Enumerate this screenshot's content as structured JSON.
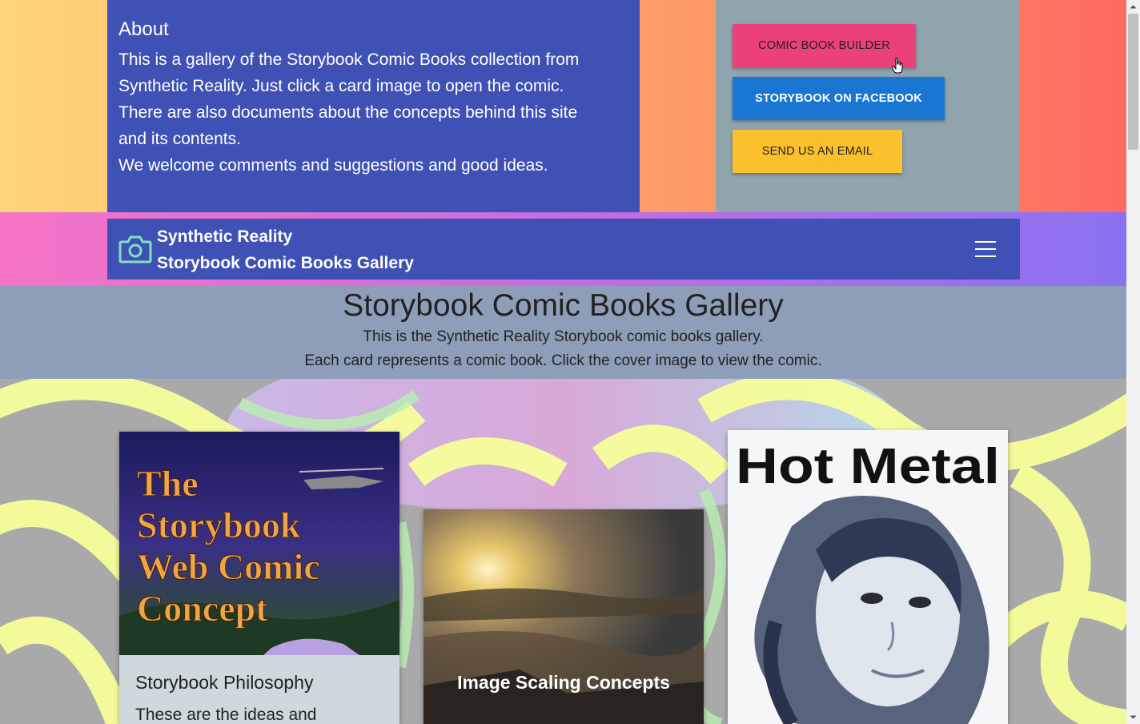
{
  "about": {
    "heading": "About",
    "line1": "This is a gallery of the Storybook Comic Books collection from",
    "line2": "Synthetic Reality. Just click a card image to open the comic.",
    "line3": "There are also documents about the concepts behind this site",
    "line4": "and its contents.",
    "line5": "We welcome comments and suggestions and good ideas."
  },
  "buttons": {
    "comic_builder": "Comic Book Builder",
    "facebook": "Storybook on Facebook",
    "email": "Send Us An Email"
  },
  "navbar": {
    "brand_line1": "Synthetic Reality",
    "brand_line2": "Storybook Comic Books Gallery",
    "menu_icon": "hamburger-icon",
    "brand_icon": "camera-icon"
  },
  "gallery": {
    "title": "Storybook Comic Books Gallery",
    "subtitle1": "This is the Synthetic Reality Storybook comic books gallery.",
    "subtitle2": "Each card represents a comic book. Click the cover image to view the comic."
  },
  "cards": [
    {
      "cover_line1": "The",
      "cover_line2": "Storybook",
      "cover_line3": "Web Comic",
      "cover_line4": "Concept",
      "title": "Storybook Philosophy",
      "description": "These are the ideas and"
    },
    {
      "cover_caption": "Image Scaling Concepts"
    },
    {
      "cover_title": "Hot Metal"
    }
  ],
  "colors": {
    "primary": "#3f51b5",
    "pink": "#ec407a",
    "blue": "#1976d2",
    "amber": "#fbc02d",
    "grey_panel": "#90a4ae"
  }
}
